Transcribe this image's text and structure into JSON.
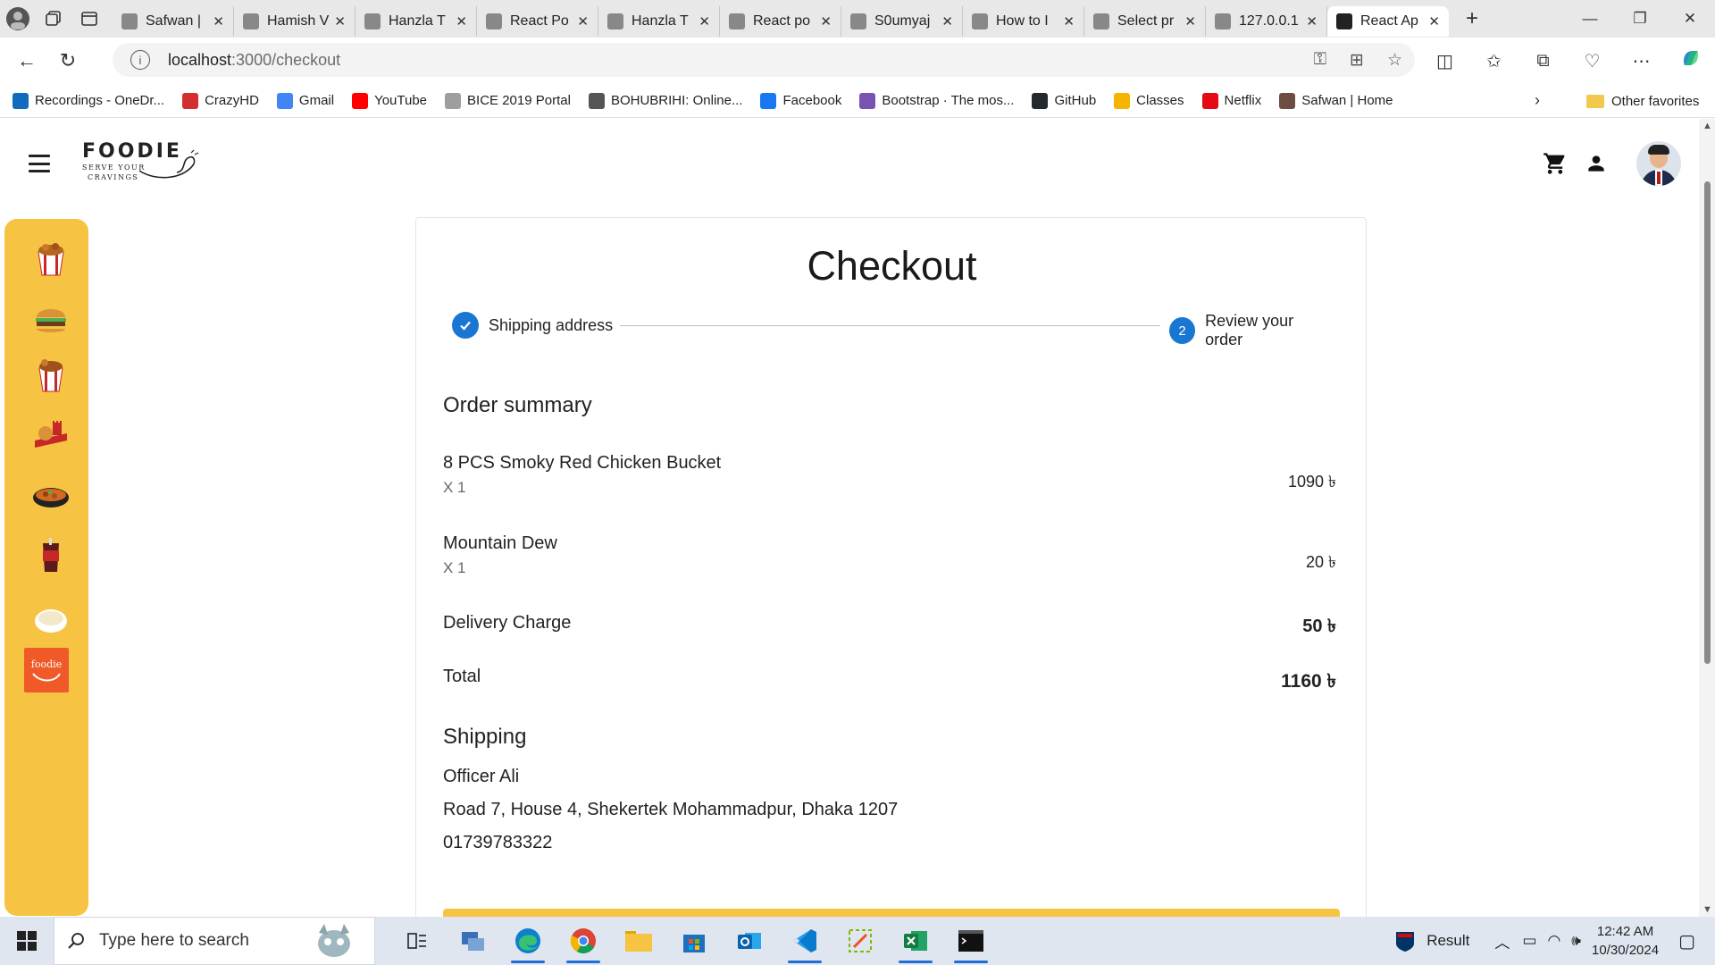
{
  "browser": {
    "tabs": [
      {
        "label": "Safwan |",
        "icon": "avatar-favicon"
      },
      {
        "label": "Hamish V",
        "icon": "w-favicon"
      },
      {
        "label": "Hanzla T",
        "icon": "code-favicon"
      },
      {
        "label": "React Po",
        "icon": "vite-favicon"
      },
      {
        "label": "Hanzla T",
        "icon": "code-favicon"
      },
      {
        "label": "React po",
        "icon": "document-favicon"
      },
      {
        "label": "S0umyaj",
        "icon": "github-favicon"
      },
      {
        "label": "How to I",
        "icon": "page-favicon"
      },
      {
        "label": "Select pr",
        "icon": "document-favicon"
      },
      {
        "label": "127.0.0.1",
        "icon": "local-favicon"
      },
      {
        "label": "React Ap",
        "icon": "react-favicon",
        "active": true
      }
    ],
    "url_host": "localhost",
    "url_path": ":3000/checkout",
    "bookmarks": [
      {
        "label": "Recordings - OneDr...",
        "icon": "onedrive-icon",
        "color": "#0f6cbd"
      },
      {
        "label": "CrazyHD",
        "icon": "hd-icon",
        "color": "#d32f2f"
      },
      {
        "label": "Gmail",
        "icon": "google-icon",
        "color": "#4285f4"
      },
      {
        "label": "YouTube",
        "icon": "youtube-icon",
        "color": "#ff0000"
      },
      {
        "label": "BICE 2019 Portal",
        "icon": "gear-icon",
        "color": "#9e9e9e"
      },
      {
        "label": "BOHUBRIHI: Online...",
        "icon": "pen-icon",
        "color": "#555555"
      },
      {
        "label": "Facebook",
        "icon": "facebook-icon",
        "color": "#1877f2"
      },
      {
        "label": "Bootstrap · The mos...",
        "icon": "bootstrap-icon",
        "color": "#7952b3"
      },
      {
        "label": "GitHub",
        "icon": "github-icon",
        "color": "#24292f"
      },
      {
        "label": "Classes",
        "icon": "classroom-icon",
        "color": "#f4b400"
      },
      {
        "label": "Netflix",
        "icon": "netflix-icon",
        "color": "#e50914"
      },
      {
        "label": "Safwan | Home",
        "icon": "avatar-icon",
        "color": "#6d4c41"
      }
    ],
    "other_favorites": "Other favorites"
  },
  "app": {
    "logo_title": "FOODIE",
    "logo_tagline_1": "SERVE YOUR",
    "logo_tagline_2": "CRAVINGS",
    "sidebar_items": [
      "chicken-bucket-icon",
      "burger-icon",
      "chicken-bucket-icon",
      "combo-meal-icon",
      "rice-bowl-icon",
      "soft-drink-icon",
      "dessert-icon",
      "foodie-logo-icon"
    ],
    "sidebar_brand_text": "foodie",
    "accent_color": "#f6c343",
    "primary_color": "#1976d2"
  },
  "checkout": {
    "title": "Checkout",
    "step1_label": "Shipping address",
    "step2_number": "2",
    "step2_label": "Review your order",
    "order_summary_heading": "Order summary",
    "items": [
      {
        "name": "8 PCS Smoky Red Chicken Bucket",
        "qty": "X 1",
        "price": "1090 ৳"
      },
      {
        "name": "Mountain Dew",
        "qty": "X 1",
        "price": "20 ৳"
      }
    ],
    "delivery_label": "Delivery Charge",
    "delivery_value": "50 ৳",
    "total_label": "Total",
    "total_value": "1160 ৳",
    "shipping_heading": "Shipping",
    "shipping_name": "Officer Ali",
    "shipping_address": "Road 7, House 4, Shekertek Mohammadpur, Dhaka 1207",
    "shipping_phone": "01739783322"
  },
  "taskbar": {
    "search_placeholder": "Type here to search",
    "tray_label": "Result",
    "time": "12:42 AM",
    "date": "10/30/2024"
  }
}
